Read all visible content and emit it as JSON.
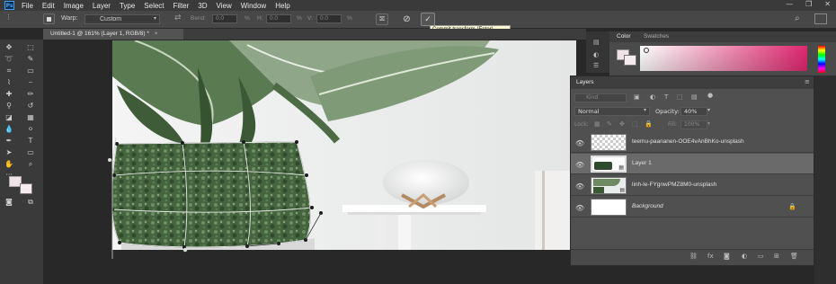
{
  "app": {
    "logo": "Ps"
  },
  "menu": [
    "File",
    "Edit",
    "Image",
    "Layer",
    "Type",
    "Select",
    "Filter",
    "3D",
    "View",
    "Window",
    "Help"
  ],
  "window_controls": [
    "—",
    "❐",
    "✕"
  ],
  "options": {
    "warp_label": "Warp:",
    "warp_value": "Custom",
    "bend_label": "Bend:",
    "bend_value": "0.0",
    "h_label": "H:",
    "h_value": "0.0",
    "v_label": "V:",
    "v_value": "0.0",
    "commit_tooltip": "Commit transform (Enter)"
  },
  "document": {
    "tab_title": "Untitled-1 @ 161% (Layer 1, RGB/8) *",
    "close": "×"
  },
  "color_panel": {
    "tabs": [
      "Color",
      "Swatches"
    ]
  },
  "layers_panel": {
    "title": "Layers",
    "kind_placeholder": "Kind",
    "blend_mode": "Normal",
    "opacity_label": "Opacity:",
    "opacity_value": "40%",
    "lock_label": "Lock:",
    "fill_label": "Fill:",
    "fill_value": "100%",
    "layers": [
      {
        "name": "teemu-paananen-OOE4vAnBhKo-unsplash",
        "thumb": "checker",
        "selected": false,
        "italic": false
      },
      {
        "name": "Layer 1",
        "thumb": "pot",
        "selected": true,
        "italic": false
      },
      {
        "name": "linh-le-FYgnwPMZ8M0-unsplash",
        "thumb": "plant",
        "selected": false,
        "italic": false
      },
      {
        "name": "Background",
        "thumb": "white",
        "selected": false,
        "italic": true
      }
    ]
  },
  "colors": {
    "accent": "#3fa3ff",
    "panel": "#505050",
    "selected_row": "#6a6a6a",
    "pot_green": "#4a6b48",
    "tooltip_bg": "#fbf8d2"
  }
}
